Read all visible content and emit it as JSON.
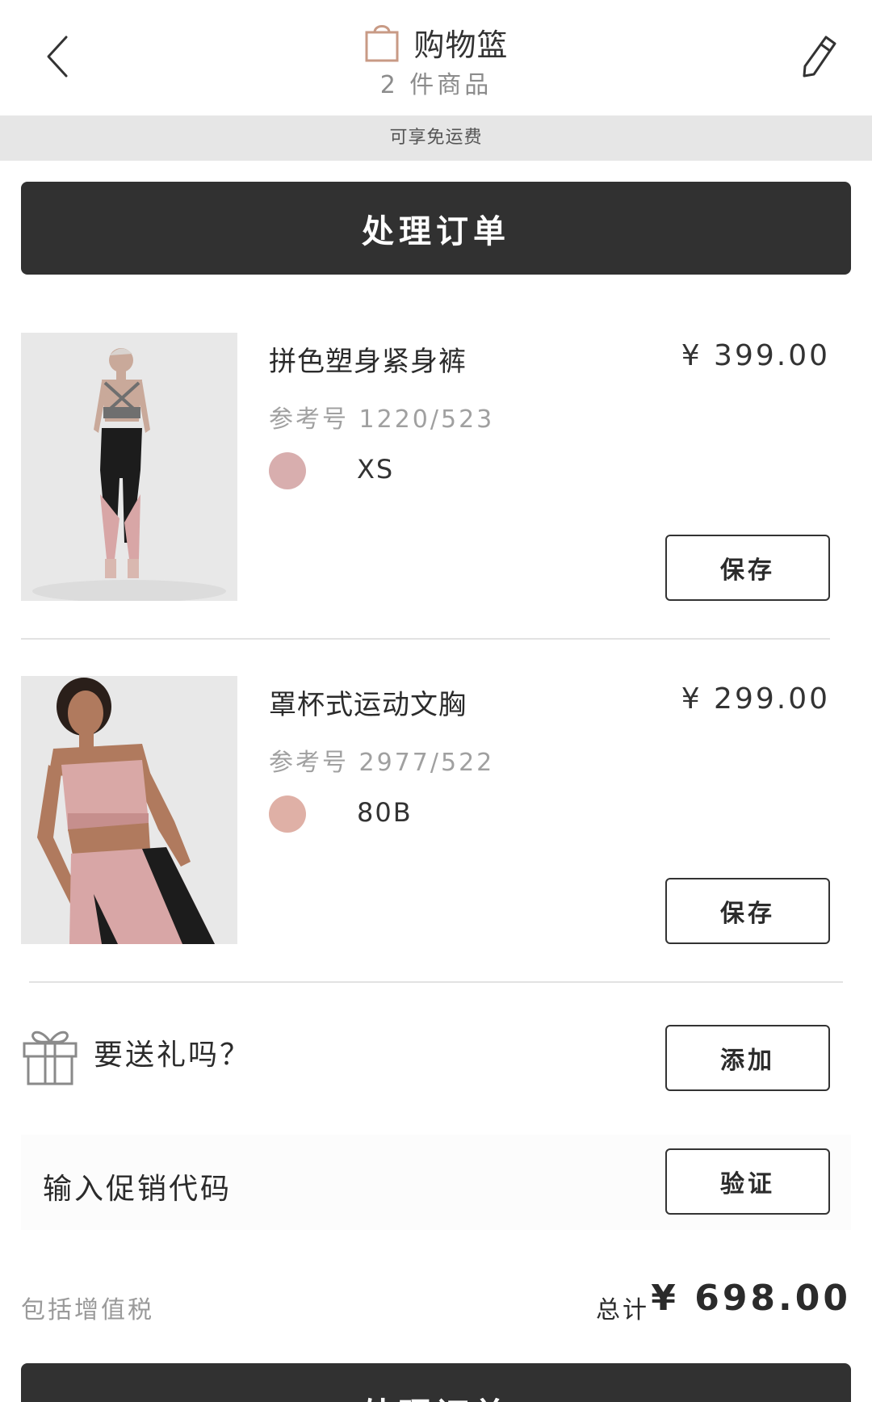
{
  "header": {
    "title": "购物篮",
    "item_count": "2 件商品"
  },
  "shipping_banner": "可享免运费",
  "checkout_label": "处理订单",
  "products": [
    {
      "name": "拼色塑身紧身裤",
      "price": "¥ 399.00",
      "ref": "参考号 1220/523",
      "size": "XS",
      "swatch_color": "#d8aeae",
      "save_label": "保存"
    },
    {
      "name": "罩杯式运动文胸",
      "price": "¥ 299.00",
      "ref": "参考号 2977/522",
      "size": "80B",
      "swatch_color": "#dfb0a6",
      "save_label": "保存"
    }
  ],
  "gift": {
    "label": "要送礼吗？",
    "button": "添加"
  },
  "promo": {
    "label": "输入促销代码",
    "button": "验证"
  },
  "totals": {
    "vat_note": "包括增值税",
    "total_label": "总计",
    "total_value": "¥ 698.00"
  },
  "colors": {
    "primary_button": "#313131",
    "banner_bg": "#e6e6e6",
    "bag_icon": "#c89a85"
  }
}
